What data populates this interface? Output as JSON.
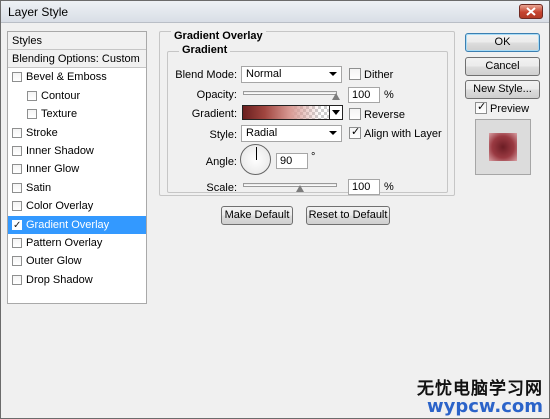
{
  "window": {
    "title": "Layer Style"
  },
  "styles_panel": {
    "header": "Styles",
    "blending": "Blending Options: Custom",
    "items": [
      {
        "label": "Bevel & Emboss",
        "checked": false,
        "sub": false,
        "selected": false
      },
      {
        "label": "Contour",
        "checked": false,
        "sub": true,
        "selected": false
      },
      {
        "label": "Texture",
        "checked": false,
        "sub": true,
        "selected": false
      },
      {
        "label": "Stroke",
        "checked": false,
        "sub": false,
        "selected": false
      },
      {
        "label": "Inner Shadow",
        "checked": false,
        "sub": false,
        "selected": false
      },
      {
        "label": "Inner Glow",
        "checked": false,
        "sub": false,
        "selected": false
      },
      {
        "label": "Satin",
        "checked": false,
        "sub": false,
        "selected": false
      },
      {
        "label": "Color Overlay",
        "checked": false,
        "sub": false,
        "selected": false
      },
      {
        "label": "Gradient Overlay",
        "checked": true,
        "sub": false,
        "selected": true
      },
      {
        "label": "Pattern Overlay",
        "checked": false,
        "sub": false,
        "selected": false
      },
      {
        "label": "Outer Glow",
        "checked": false,
        "sub": false,
        "selected": false
      },
      {
        "label": "Drop Shadow",
        "checked": false,
        "sub": false,
        "selected": false
      }
    ]
  },
  "gradient_overlay": {
    "group_title": "Gradient Overlay",
    "subgroup_title": "Gradient",
    "blend_mode_label": "Blend Mode:",
    "blend_mode_value": "Normal",
    "dither_label": "Dither",
    "dither_checked": false,
    "opacity_label": "Opacity:",
    "opacity_value": "100",
    "opacity_unit": "%",
    "gradient_label": "Gradient:",
    "reverse_label": "Reverse",
    "reverse_checked": false,
    "style_label": "Style:",
    "style_value": "Radial",
    "align_label": "Align with Layer",
    "align_checked": true,
    "angle_label": "Angle:",
    "angle_value": "90",
    "angle_unit": "°",
    "scale_label": "Scale:",
    "scale_value": "100",
    "scale_unit": "%",
    "make_default": "Make Default",
    "reset_default": "Reset to Default"
  },
  "buttons": {
    "ok": "OK",
    "cancel": "Cancel",
    "new_style": "New Style...",
    "preview_label": "Preview",
    "preview_checked": true
  },
  "watermark": {
    "cn": "无忧电脑学习网",
    "url": "wypcw.com"
  },
  "colors": {
    "selection": "#3399ff",
    "gradient_dark": "#6a1f1f",
    "gradient_mid": "#d99b95"
  }
}
